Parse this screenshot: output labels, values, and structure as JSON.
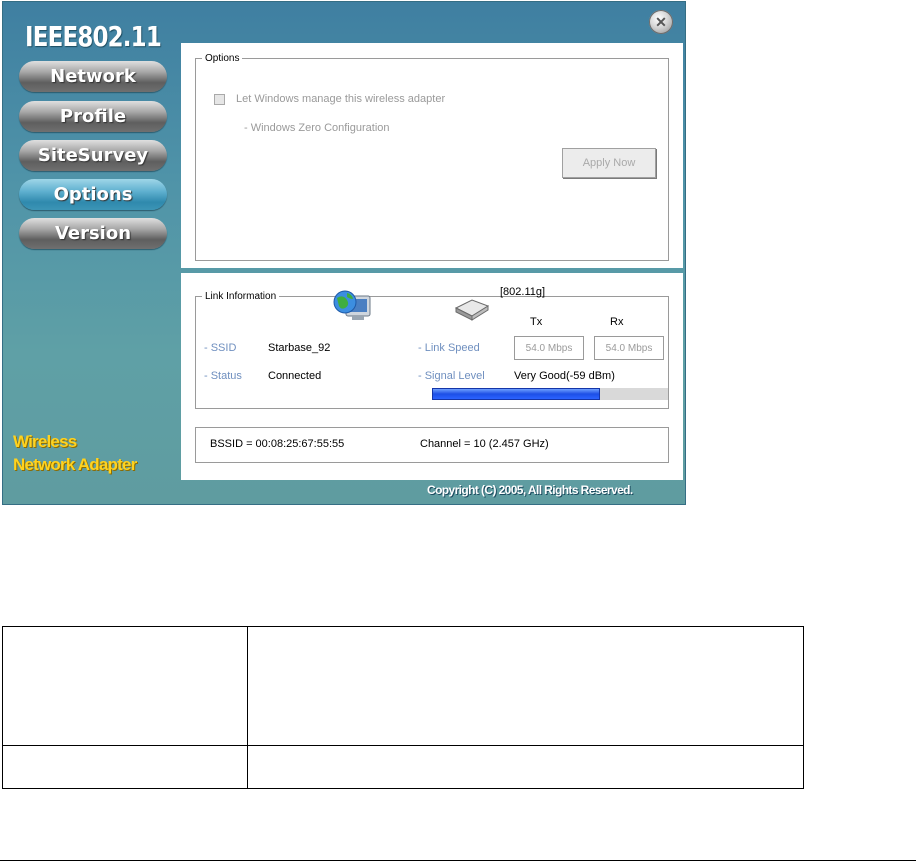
{
  "app": {
    "title": "IEEE802.11",
    "brand_line1": "Wireless",
    "brand_line2": "Network Adapter",
    "copyright": "Copyright (C) 2005, All Rights Reserved."
  },
  "nav": {
    "items": [
      {
        "label": "Network",
        "active": false
      },
      {
        "label": "Profile",
        "active": false
      },
      {
        "label": "SiteSurvey",
        "active": false
      },
      {
        "label": "Options",
        "active": true
      },
      {
        "label": "Version",
        "active": false
      }
    ]
  },
  "options": {
    "legend": "Options",
    "manage_label": "Let Windows manage this wireless adapter",
    "manage_checked": false,
    "wzc_label": "- Windows Zero Configuration",
    "apply_label": "Apply Now"
  },
  "link": {
    "legend": "Link Information",
    "mode": "[802.11g]",
    "ssid_label": "- SSID",
    "ssid_value": "Starbase_92",
    "status_label": "- Status",
    "status_value": "Connected",
    "speed_label": "- Link Speed",
    "tx_label": "Tx",
    "rx_label": "Rx",
    "tx_value": "54.0 Mbps",
    "rx_value": "54.0 Mbps",
    "signal_label": "- Signal Level",
    "signal_value": "Very Good(-59 dBm)",
    "signal_fraction": 0.71,
    "bssid": "BSSID = 00:08:25:67:55:55",
    "channel": "Channel = 10 (2.457 GHz)"
  },
  "icons": {
    "close": "close-icon",
    "network": "network-computer-icon",
    "router": "router-icon"
  }
}
